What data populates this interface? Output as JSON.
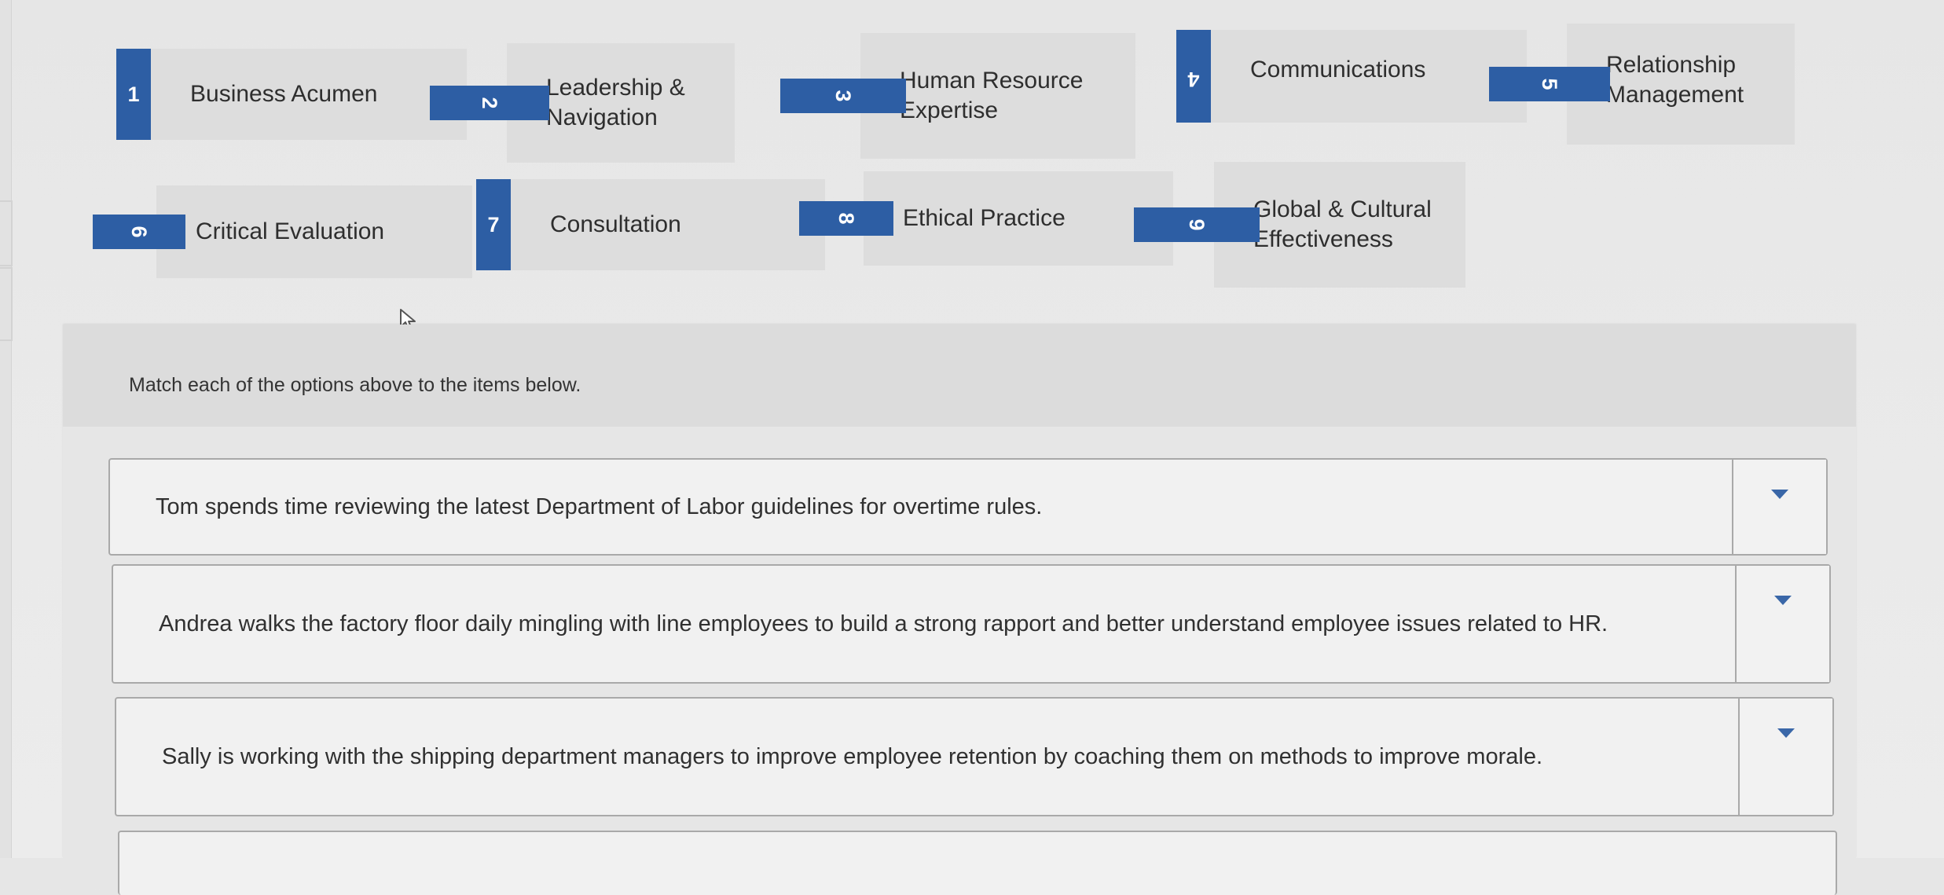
{
  "options": [
    {
      "number": "1",
      "label": "Business Acumen"
    },
    {
      "number": "2",
      "label": "Leadership & Navigation"
    },
    {
      "number": "3",
      "label": "Human Resource Expertise"
    },
    {
      "number": "4",
      "label": "Communications"
    },
    {
      "number": "5",
      "label": "Relationship Management"
    },
    {
      "number": "6",
      "label": "Critical Evaluation"
    },
    {
      "number": "7",
      "label": "Consultation"
    },
    {
      "number": "8",
      "label": "Ethical Practice"
    },
    {
      "number": "9",
      "label": "Global & Cultural Effectiveness"
    }
  ],
  "instructions": "Match each of the options above to the items below.",
  "items": [
    {
      "text": "Tom spends time reviewing the latest Department of Labor guidelines for overtime rules."
    },
    {
      "text": "Andrea walks the factory floor daily mingling with line employees to build a strong rapport and better understand employee issues related to HR."
    },
    {
      "text": "Sally is working with the shipping department managers to improve employee retention by coaching them on methods to improve morale."
    }
  ],
  "icons": {
    "caret": "chevron-down-icon",
    "cursor": "mouse-pointer-icon"
  },
  "colors": {
    "accent": "#2d5ea4",
    "chip_background": "#dddddd",
    "page_background": "#e8e8e8"
  }
}
